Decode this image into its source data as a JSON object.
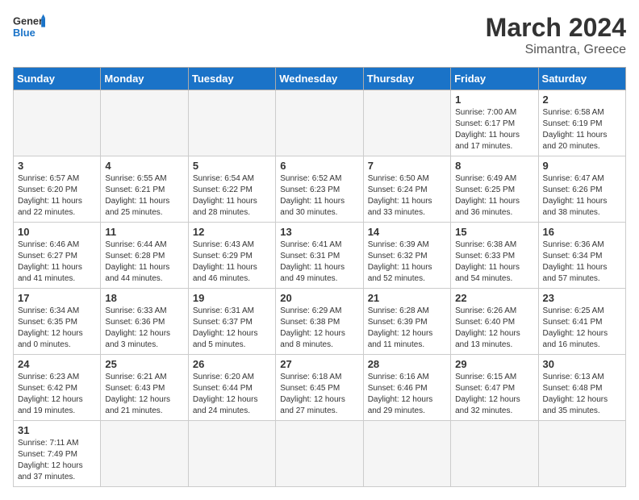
{
  "header": {
    "logo_general": "General",
    "logo_blue": "Blue",
    "title": "March 2024",
    "subtitle": "Simantra, Greece"
  },
  "weekdays": [
    "Sunday",
    "Monday",
    "Tuesday",
    "Wednesday",
    "Thursday",
    "Friday",
    "Saturday"
  ],
  "weeks": [
    [
      {
        "day": "",
        "info": ""
      },
      {
        "day": "",
        "info": ""
      },
      {
        "day": "",
        "info": ""
      },
      {
        "day": "",
        "info": ""
      },
      {
        "day": "",
        "info": ""
      },
      {
        "day": "1",
        "info": "Sunrise: 7:00 AM\nSunset: 6:17 PM\nDaylight: 11 hours and 17 minutes."
      },
      {
        "day": "2",
        "info": "Sunrise: 6:58 AM\nSunset: 6:19 PM\nDaylight: 11 hours and 20 minutes."
      }
    ],
    [
      {
        "day": "3",
        "info": "Sunrise: 6:57 AM\nSunset: 6:20 PM\nDaylight: 11 hours and 22 minutes."
      },
      {
        "day": "4",
        "info": "Sunrise: 6:55 AM\nSunset: 6:21 PM\nDaylight: 11 hours and 25 minutes."
      },
      {
        "day": "5",
        "info": "Sunrise: 6:54 AM\nSunset: 6:22 PM\nDaylight: 11 hours and 28 minutes."
      },
      {
        "day": "6",
        "info": "Sunrise: 6:52 AM\nSunset: 6:23 PM\nDaylight: 11 hours and 30 minutes."
      },
      {
        "day": "7",
        "info": "Sunrise: 6:50 AM\nSunset: 6:24 PM\nDaylight: 11 hours and 33 minutes."
      },
      {
        "day": "8",
        "info": "Sunrise: 6:49 AM\nSunset: 6:25 PM\nDaylight: 11 hours and 36 minutes."
      },
      {
        "day": "9",
        "info": "Sunrise: 6:47 AM\nSunset: 6:26 PM\nDaylight: 11 hours and 38 minutes."
      }
    ],
    [
      {
        "day": "10",
        "info": "Sunrise: 6:46 AM\nSunset: 6:27 PM\nDaylight: 11 hours and 41 minutes."
      },
      {
        "day": "11",
        "info": "Sunrise: 6:44 AM\nSunset: 6:28 PM\nDaylight: 11 hours and 44 minutes."
      },
      {
        "day": "12",
        "info": "Sunrise: 6:43 AM\nSunset: 6:29 PM\nDaylight: 11 hours and 46 minutes."
      },
      {
        "day": "13",
        "info": "Sunrise: 6:41 AM\nSunset: 6:31 PM\nDaylight: 11 hours and 49 minutes."
      },
      {
        "day": "14",
        "info": "Sunrise: 6:39 AM\nSunset: 6:32 PM\nDaylight: 11 hours and 52 minutes."
      },
      {
        "day": "15",
        "info": "Sunrise: 6:38 AM\nSunset: 6:33 PM\nDaylight: 11 hours and 54 minutes."
      },
      {
        "day": "16",
        "info": "Sunrise: 6:36 AM\nSunset: 6:34 PM\nDaylight: 11 hours and 57 minutes."
      }
    ],
    [
      {
        "day": "17",
        "info": "Sunrise: 6:34 AM\nSunset: 6:35 PM\nDaylight: 12 hours and 0 minutes."
      },
      {
        "day": "18",
        "info": "Sunrise: 6:33 AM\nSunset: 6:36 PM\nDaylight: 12 hours and 3 minutes."
      },
      {
        "day": "19",
        "info": "Sunrise: 6:31 AM\nSunset: 6:37 PM\nDaylight: 12 hours and 5 minutes."
      },
      {
        "day": "20",
        "info": "Sunrise: 6:29 AM\nSunset: 6:38 PM\nDaylight: 12 hours and 8 minutes."
      },
      {
        "day": "21",
        "info": "Sunrise: 6:28 AM\nSunset: 6:39 PM\nDaylight: 12 hours and 11 minutes."
      },
      {
        "day": "22",
        "info": "Sunrise: 6:26 AM\nSunset: 6:40 PM\nDaylight: 12 hours and 13 minutes."
      },
      {
        "day": "23",
        "info": "Sunrise: 6:25 AM\nSunset: 6:41 PM\nDaylight: 12 hours and 16 minutes."
      }
    ],
    [
      {
        "day": "24",
        "info": "Sunrise: 6:23 AM\nSunset: 6:42 PM\nDaylight: 12 hours and 19 minutes."
      },
      {
        "day": "25",
        "info": "Sunrise: 6:21 AM\nSunset: 6:43 PM\nDaylight: 12 hours and 21 minutes."
      },
      {
        "day": "26",
        "info": "Sunrise: 6:20 AM\nSunset: 6:44 PM\nDaylight: 12 hours and 24 minutes."
      },
      {
        "day": "27",
        "info": "Sunrise: 6:18 AM\nSunset: 6:45 PM\nDaylight: 12 hours and 27 minutes."
      },
      {
        "day": "28",
        "info": "Sunrise: 6:16 AM\nSunset: 6:46 PM\nDaylight: 12 hours and 29 minutes."
      },
      {
        "day": "29",
        "info": "Sunrise: 6:15 AM\nSunset: 6:47 PM\nDaylight: 12 hours and 32 minutes."
      },
      {
        "day": "30",
        "info": "Sunrise: 6:13 AM\nSunset: 6:48 PM\nDaylight: 12 hours and 35 minutes."
      }
    ],
    [
      {
        "day": "31",
        "info": "Sunrise: 7:11 AM\nSunset: 7:49 PM\nDaylight: 12 hours and 37 minutes."
      },
      {
        "day": "",
        "info": ""
      },
      {
        "day": "",
        "info": ""
      },
      {
        "day": "",
        "info": ""
      },
      {
        "day": "",
        "info": ""
      },
      {
        "day": "",
        "info": ""
      },
      {
        "day": "",
        "info": ""
      }
    ]
  ]
}
